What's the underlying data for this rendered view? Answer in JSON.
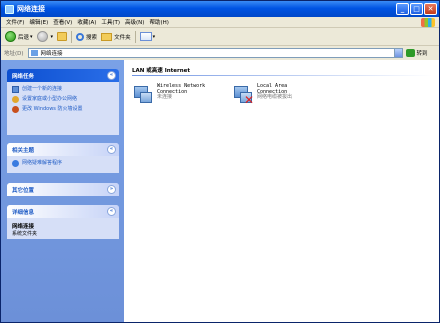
{
  "window": {
    "title": "网络连接",
    "buttons": {
      "minimize": "_",
      "maximize": "□",
      "close": "✕"
    }
  },
  "menu": [
    "文件(F)",
    "编辑(E)",
    "查看(V)",
    "收藏(A)",
    "工具(T)",
    "高级(N)",
    "帮助(H)"
  ],
  "toolbar": {
    "back_label": "后退",
    "search_label": "搜索",
    "folders_label": "文件夹"
  },
  "address": {
    "label": "地址(D)",
    "value": "网络连接",
    "go_label": "转到"
  },
  "sidebar": {
    "network_tasks": {
      "title": "网络任务",
      "items": [
        "创建一个新的连接",
        "设置家庭或小型办公网络",
        "更改 Windows 防火墙设置"
      ]
    },
    "see_also": {
      "title": "相关主题",
      "items": [
        "网络疑难解答程序"
      ]
    },
    "other_places": {
      "title": "其它位置"
    },
    "details": {
      "title": "详细信息",
      "name": "网络连接",
      "sub": "系统文件夹"
    }
  },
  "main": {
    "group_title": "LAN 或高速 Internet",
    "connections": [
      {
        "name_line1": "Wireless Network",
        "name_line2": "Connection",
        "status": "未连接"
      },
      {
        "name_line1": "Local Area",
        "name_line2": "Connection",
        "status": "网络电缆被拔出"
      }
    ]
  }
}
